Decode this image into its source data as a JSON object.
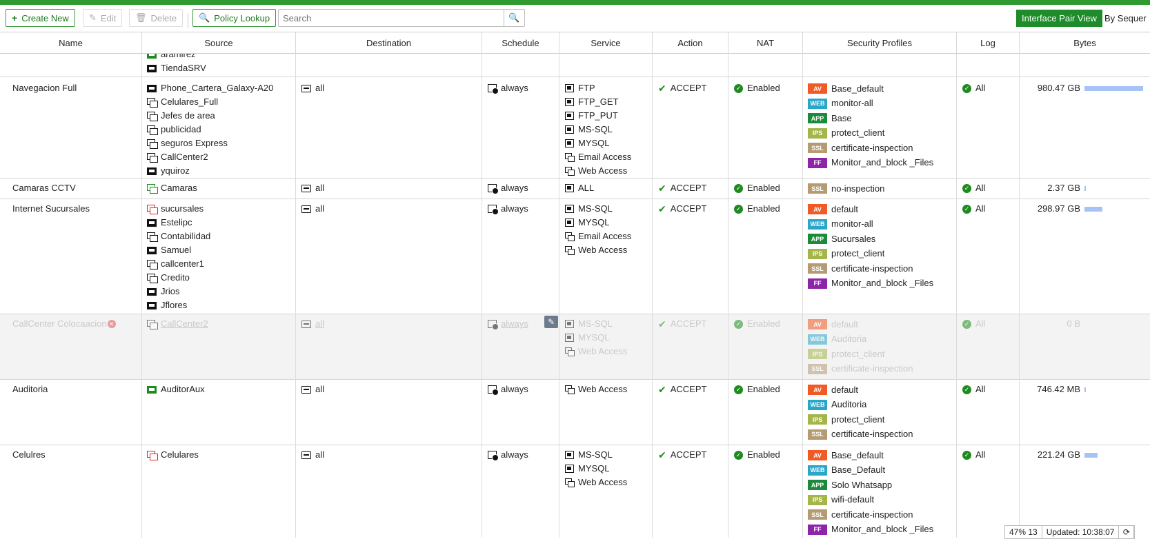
{
  "toolbar": {
    "create_new": "Create New",
    "edit": "Edit",
    "delete": "Delete",
    "policy_lookup": "Policy Lookup",
    "search_placeholder": "Search",
    "interface_pair_view": "Interface Pair View",
    "by_sequence": "By Sequer"
  },
  "columns": [
    "Name",
    "Source",
    "Destination",
    "Schedule",
    "Service",
    "Action",
    "NAT",
    "Security Profiles",
    "Log",
    "Bytes"
  ],
  "partial_row": {
    "sources": [
      "aramirez",
      "TiendaSRV"
    ]
  },
  "rows": [
    {
      "name": "Navegacion Full",
      "sources": [
        "Phone_Cartera_Galaxy-A20",
        "Celulares_Full",
        "Jefes de area",
        "publicidad",
        "seguros Express",
        "CallCenter2",
        "yquiroz"
      ],
      "destination": "all",
      "schedule": "always",
      "services": [
        "FTP",
        "FTP_GET",
        "FTP_PUT",
        "MS-SQL",
        "MYSQL",
        "Email Access",
        "Web Access"
      ],
      "action": "ACCEPT",
      "nat": "Enabled",
      "profiles": [
        {
          "type": "AV",
          "name": "Base_default"
        },
        {
          "type": "WEB",
          "name": "monitor-all"
        },
        {
          "type": "APP",
          "name": "Base"
        },
        {
          "type": "IPS",
          "name": "protect_client"
        },
        {
          "type": "SSL",
          "name": "certificate-inspection"
        },
        {
          "type": "FF",
          "name": "Monitor_and_block _Files"
        }
      ],
      "log": "All",
      "bytes": "980.47 GB",
      "bytes_fraction": 1.0
    },
    {
      "name": "Camaras CCTV",
      "sources": [
        "Camaras"
      ],
      "destination": "all",
      "schedule": "always",
      "services": [
        "ALL"
      ],
      "action": "ACCEPT",
      "nat": "Enabled",
      "profiles": [
        {
          "type": "SSL",
          "name": "no-inspection"
        }
      ],
      "log": "All",
      "bytes": "2.37 GB",
      "bytes_fraction": 0.01
    },
    {
      "name": "Internet Sucursales",
      "sources": [
        "sucursales",
        "Estelipc",
        "Contabilidad",
        "Samuel",
        "callcenter1",
        "Credito",
        "Jrios",
        "Jflores"
      ],
      "destination": "all",
      "schedule": "always",
      "services": [
        "MS-SQL",
        "MYSQL",
        "Email Access",
        "Web Access"
      ],
      "action": "ACCEPT",
      "nat": "Enabled",
      "profiles": [
        {
          "type": "AV",
          "name": "default"
        },
        {
          "type": "WEB",
          "name": "monitor-all"
        },
        {
          "type": "APP",
          "name": "Sucursales"
        },
        {
          "type": "IPS",
          "name": "protect_client"
        },
        {
          "type": "SSL",
          "name": "certificate-inspection"
        },
        {
          "type": "FF",
          "name": "Monitor_and_block _Files"
        }
      ],
      "log": "All",
      "bytes": "298.97 GB",
      "bytes_fraction": 0.3
    },
    {
      "name": "CallCenter Colocaacion",
      "disabled": true,
      "sources": [
        "CallCenter2"
      ],
      "destination": "all",
      "schedule": "always",
      "services": [
        "MS-SQL",
        "MYSQL",
        "Web Access"
      ],
      "action": "ACCEPT",
      "nat": "Enabled",
      "profiles": [
        {
          "type": "AV",
          "name": "default"
        },
        {
          "type": "WEB",
          "name": "Auditoria"
        },
        {
          "type": "IPS",
          "name": "protect_client"
        },
        {
          "type": "SSL",
          "name": "certificate-inspection"
        }
      ],
      "log": "All",
      "bytes": "0 B",
      "bytes_fraction": 0
    },
    {
      "name": "Auditoria",
      "sources": [
        "AuditorAux"
      ],
      "destination": "all",
      "schedule": "always",
      "services": [
        "Web Access"
      ],
      "action": "ACCEPT",
      "nat": "Enabled",
      "profiles": [
        {
          "type": "AV",
          "name": "default"
        },
        {
          "type": "WEB",
          "name": "Auditoria"
        },
        {
          "type": "IPS",
          "name": "protect_client"
        },
        {
          "type": "SSL",
          "name": "certificate-inspection"
        }
      ],
      "log": "All",
      "bytes": "746.42 MB",
      "bytes_fraction": 0.005
    },
    {
      "name": "Celulres",
      "sources": [
        "Celulares"
      ],
      "destination": "all",
      "schedule": "always",
      "services": [
        "MS-SQL",
        "MYSQL",
        "Web Access"
      ],
      "action": "ACCEPT",
      "nat": "Enabled",
      "profiles": [
        {
          "type": "AV",
          "name": "Base_default"
        },
        {
          "type": "WEB",
          "name": "Base_Default"
        },
        {
          "type": "APP",
          "name": "Solo Whatsapp"
        },
        {
          "type": "IPS",
          "name": "wifi-default"
        },
        {
          "type": "SSL",
          "name": "certificate-inspection"
        },
        {
          "type": "FF",
          "name": "Monitor_and_block _Files"
        }
      ],
      "log": "All",
      "bytes": "221.24 GB",
      "bytes_fraction": 0.22
    }
  ],
  "status": {
    "percent": "47% 13",
    "updated": "Updated: 10:38:07"
  },
  "colors": {
    "accent": "#2f9a2f",
    "badge_av": "#f15a24",
    "badge_web": "#2aa6c9",
    "badge_app": "#1b8a3a",
    "badge_ips": "#a4b64a",
    "badge_ssl": "#b59b73",
    "badge_ff": "#8e24aa",
    "bytes_bar": "#a7c2f5"
  }
}
